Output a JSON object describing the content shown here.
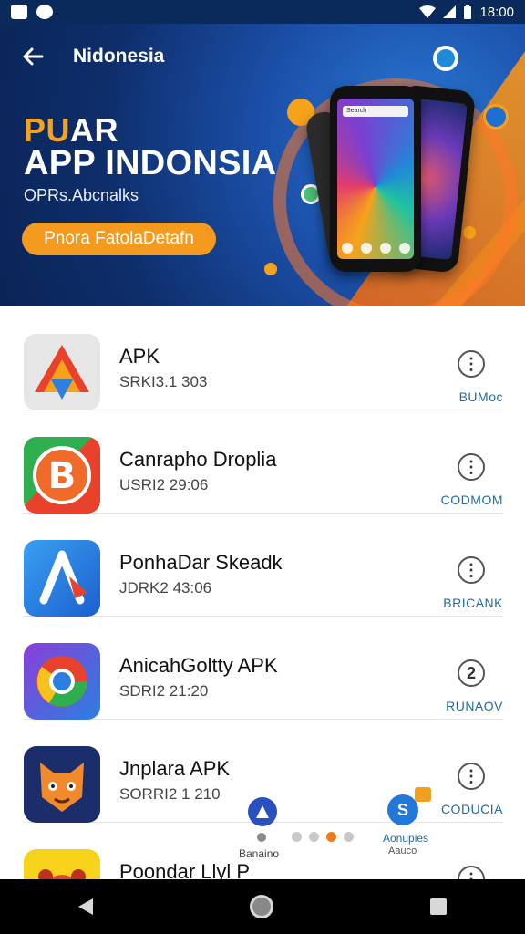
{
  "status_bar": {
    "time": "18:00"
  },
  "header": {
    "title": "Nidonesia"
  },
  "hero": {
    "title_accent": "PU",
    "title_rest": "AR",
    "title_line2": "APP INDONSIA",
    "subtitle": "OPRs.Abcnalks",
    "button_label": "Pnora FatolaDetafn",
    "phone_screen_bar": "Search"
  },
  "apps": [
    {
      "name": "APK",
      "meta": "SRKI3.1 303",
      "action": "BUMoc"
    },
    {
      "name": "Canrapho Droplia",
      "meta": "USRI2 29:06",
      "action": "CODMOM"
    },
    {
      "name": "PonhaDar Skeadk",
      "meta": "JDRK2 43:06",
      "action": "BRICANK"
    },
    {
      "name": "AnicahGoltty APK",
      "meta": "SDRI2 21:20",
      "action": "RUNAOV"
    },
    {
      "name": "Jnplara APK",
      "meta": "SORRI2 1 210",
      "action": "CODUCIA"
    },
    {
      "name": "Poondar Llyl P",
      "meta": "",
      "action": ""
    }
  ],
  "more_icon_glyphs": [
    "⋮",
    "⋮",
    "⋮",
    "2",
    "⋮",
    "⋮"
  ],
  "floating": {
    "left_label": "Banaino",
    "right_label": "Aonupies",
    "right_sub": "Aauco"
  },
  "pager": {
    "count": 5,
    "active_index": 3
  },
  "colors": {
    "accent": "#f39a1f",
    "link": "#1e6aa8",
    "hero_bg": "#0e2e6b"
  }
}
